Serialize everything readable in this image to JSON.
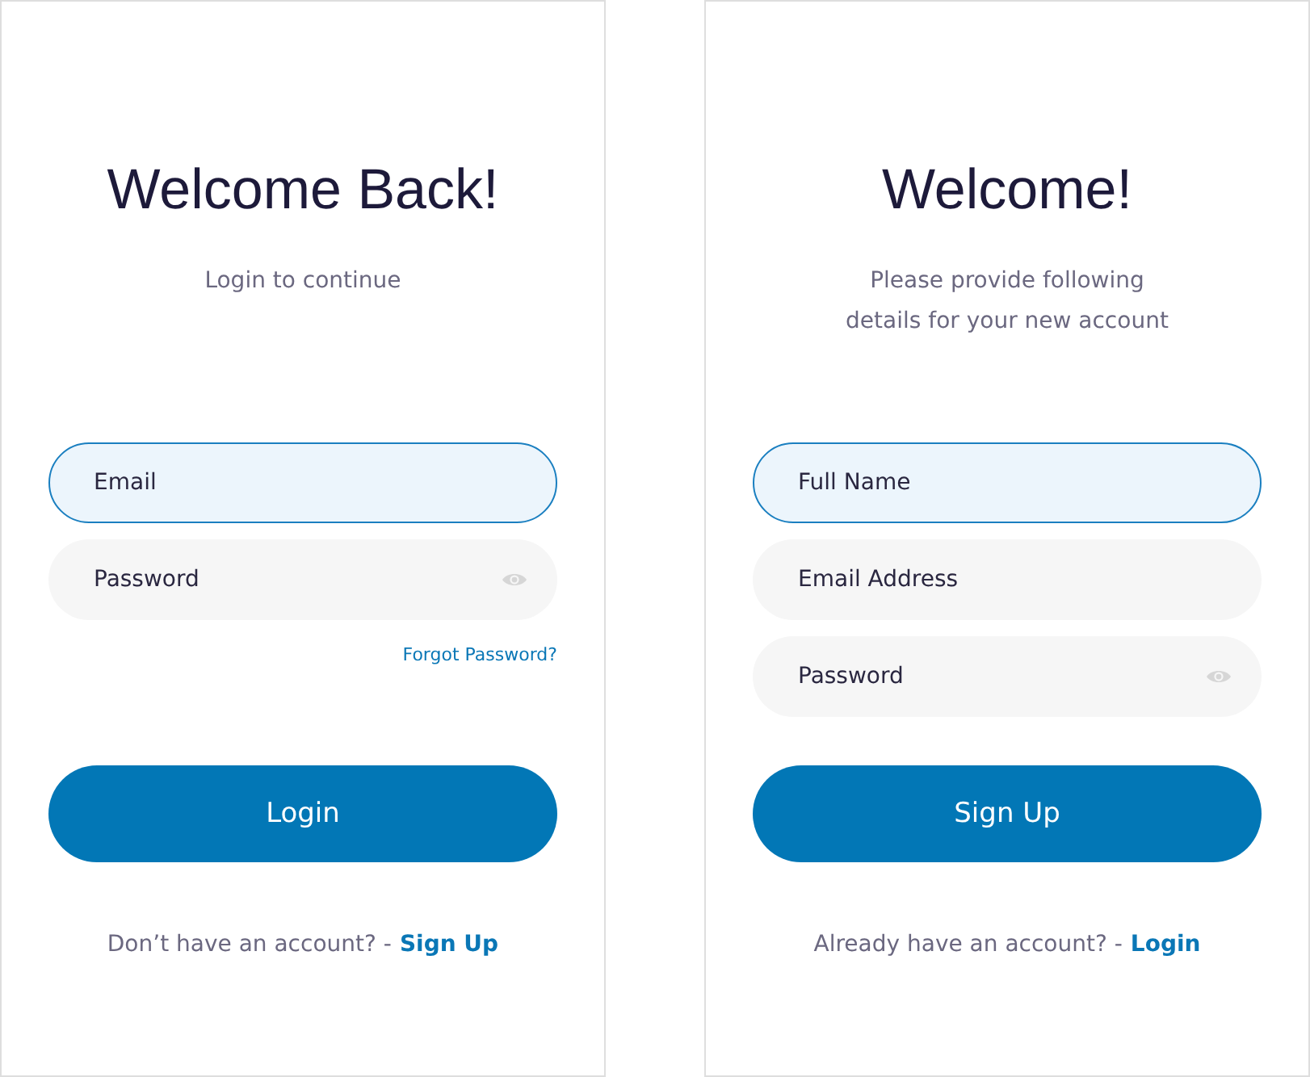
{
  "screens": [
    {
      "title": "Welcome Back!",
      "subtitle": "Login to continue",
      "fields": [
        {
          "placeholder": "Email",
          "kind": "text",
          "focused": true
        },
        {
          "placeholder": "Password",
          "kind": "password",
          "focused": false
        }
      ],
      "forgot_link": "Forgot Password?",
      "button": "Login",
      "footer": {
        "text": "Don’t have an account? -",
        "link": "Sign Up"
      }
    },
    {
      "title": "Welcome!",
      "subtitle": "Please provide following details for your new account",
      "fields": [
        {
          "placeholder": "Full Name",
          "kind": "text",
          "focused": true
        },
        {
          "placeholder": "Email Address",
          "kind": "text",
          "focused": false
        },
        {
          "placeholder": "Password",
          "kind": "password",
          "focused": false
        }
      ],
      "button": "Sign Up",
      "footer": {
        "text": "Already have an account? -",
        "link": "Login"
      }
    }
  ]
}
